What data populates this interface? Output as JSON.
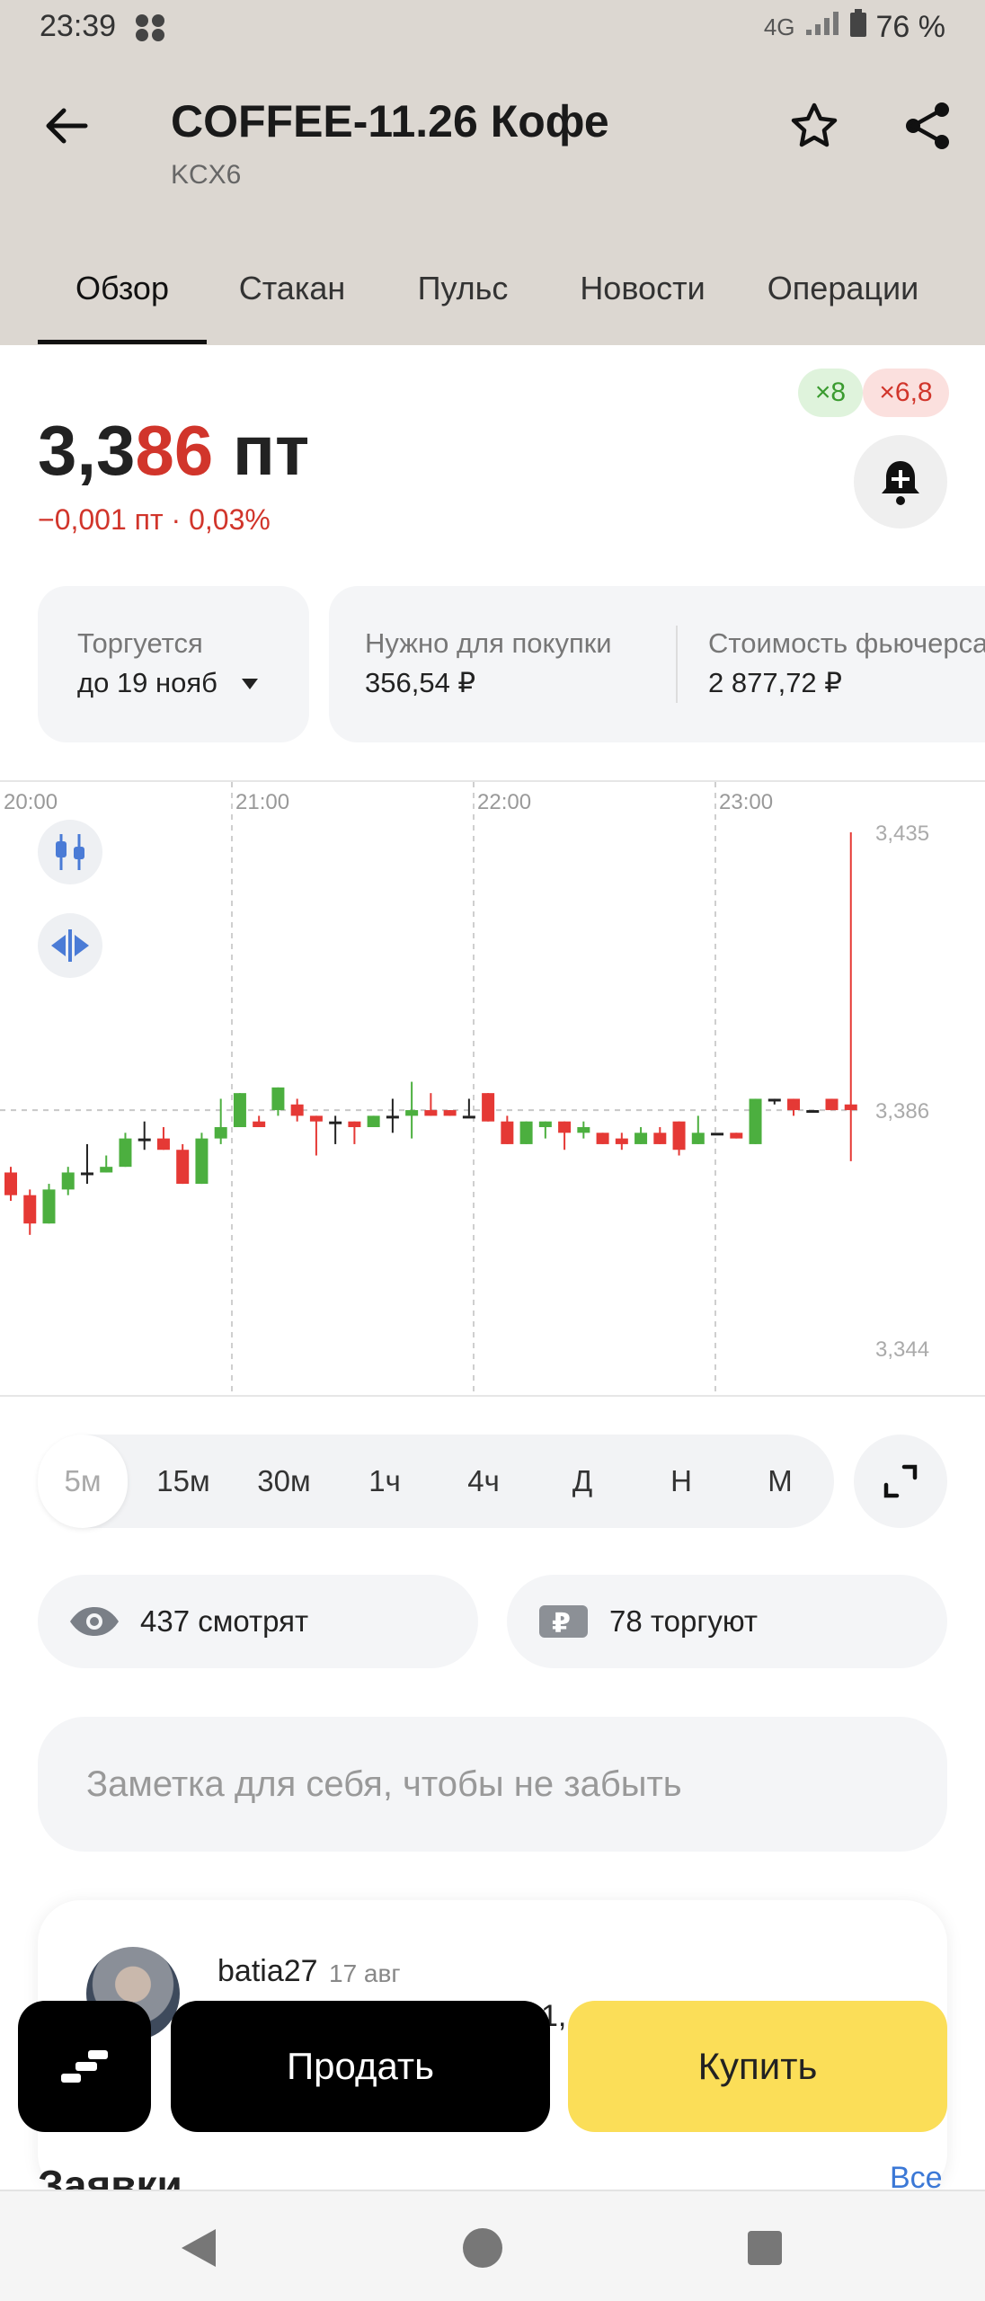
{
  "status_bar": {
    "time": "23:39",
    "network": "4G",
    "battery": "76 %"
  },
  "header": {
    "title": "COFFEE-11.26 Кофе",
    "ticker": "KCX6"
  },
  "tabs": [
    "Обзор",
    "Стакан",
    "Пульс",
    "Новости",
    "Операции"
  ],
  "badges": {
    "long": "×8",
    "short": "×6,8"
  },
  "price": {
    "main": "3,3",
    "accent": "86",
    "unit": " пт",
    "change": "−0,001 пт · 0,03%"
  },
  "info_cards": {
    "trading": {
      "label": "Торгуется",
      "value": "до 19 нояб"
    },
    "needed": {
      "label": "Нужно для покупки",
      "value": "356,54 ₽"
    },
    "cost": {
      "label": "Стоимость фьючерса",
      "value": "2 877,72 ₽"
    }
  },
  "chart_data": {
    "type": "candlestick",
    "x_labels": [
      "20:00",
      "21:00",
      "22:00",
      "23:00"
    ],
    "y_labels": [
      "3,435",
      "3,386",
      "3,344"
    ],
    "ylim": [
      3.344,
      3.435
    ],
    "current_price": 3.386,
    "colors": {
      "up": "#4caf3f",
      "down": "#e53935"
    },
    "candles": [
      [
        3.375,
        3.371,
        3.376,
        3.37
      ],
      [
        3.371,
        3.366,
        3.372,
        3.364
      ],
      [
        3.366,
        3.372,
        3.373,
        3.366
      ],
      [
        3.372,
        3.375,
        3.376,
        3.371
      ],
      [
        3.375,
        3.375,
        3.38,
        3.373
      ],
      [
        3.375,
        3.376,
        3.378,
        3.375
      ],
      [
        3.376,
        3.381,
        3.382,
        3.376
      ],
      [
        3.381,
        3.381,
        3.384,
        3.379
      ],
      [
        3.381,
        3.379,
        3.383,
        3.379
      ],
      [
        3.379,
        3.373,
        3.38,
        3.373
      ],
      [
        3.373,
        3.381,
        3.382,
        3.373
      ],
      [
        3.381,
        3.383,
        3.388,
        3.38
      ],
      [
        3.383,
        3.389,
        3.389,
        3.383
      ],
      [
        3.384,
        3.383,
        3.385,
        3.383
      ],
      [
        3.386,
        3.39,
        3.39,
        3.385
      ],
      [
        3.387,
        3.385,
        3.388,
        3.384
      ],
      [
        3.385,
        3.384,
        3.385,
        3.378
      ],
      [
        3.384,
        3.384,
        3.385,
        3.38
      ],
      [
        3.384,
        3.383,
        3.384,
        3.38
      ],
      [
        3.383,
        3.385,
        3.385,
        3.383
      ],
      [
        3.385,
        3.385,
        3.388,
        3.382
      ],
      [
        3.385,
        3.386,
        3.391,
        3.381
      ],
      [
        3.386,
        3.385,
        3.389,
        3.385
      ],
      [
        3.386,
        3.385,
        3.386,
        3.385
      ],
      [
        3.385,
        3.385,
        3.388,
        3.385
      ],
      [
        3.389,
        3.384,
        3.389,
        3.384
      ],
      [
        3.384,
        3.38,
        3.385,
        3.38
      ],
      [
        3.38,
        3.384,
        3.384,
        3.38
      ],
      [
        3.383,
        3.384,
        3.384,
        3.381
      ],
      [
        3.384,
        3.382,
        3.384,
        3.379
      ],
      [
        3.382,
        3.383,
        3.384,
        3.381
      ],
      [
        3.382,
        3.38,
        3.382,
        3.38
      ],
      [
        3.381,
        3.38,
        3.382,
        3.379
      ],
      [
        3.38,
        3.382,
        3.383,
        3.38
      ],
      [
        3.382,
        3.38,
        3.383,
        3.38
      ],
      [
        3.384,
        3.379,
        3.384,
        3.378
      ],
      [
        3.38,
        3.382,
        3.385,
        3.38
      ],
      [
        3.382,
        3.382,
        3.382,
        3.382
      ],
      [
        3.382,
        3.381,
        3.382,
        3.381
      ],
      [
        3.38,
        3.388,
        3.388,
        3.38
      ],
      [
        3.388,
        3.388,
        3.388,
        3.387
      ],
      [
        3.388,
        3.386,
        3.388,
        3.385
      ],
      [
        3.386,
        3.386,
        3.386,
        3.386
      ],
      [
        3.388,
        3.386,
        3.388,
        3.386
      ],
      [
        3.387,
        3.386,
        3.435,
        3.377
      ]
    ]
  },
  "timeframes": [
    "5м",
    "15м",
    "30м",
    "1ч",
    "4ч",
    "Д",
    "Н",
    "М"
  ],
  "stats": {
    "watching": "437 смотрят",
    "trading": "78 торгуют"
  },
  "note_placeholder": "Заметка для себя, чтобы не забыть",
  "post": {
    "user": "batia27",
    "date": "17 авг",
    "snippet": "1, г"
  },
  "actions": {
    "sell": "Продать",
    "buy": "Купить"
  },
  "orders": {
    "title": "Заявки",
    "all": "Все"
  }
}
